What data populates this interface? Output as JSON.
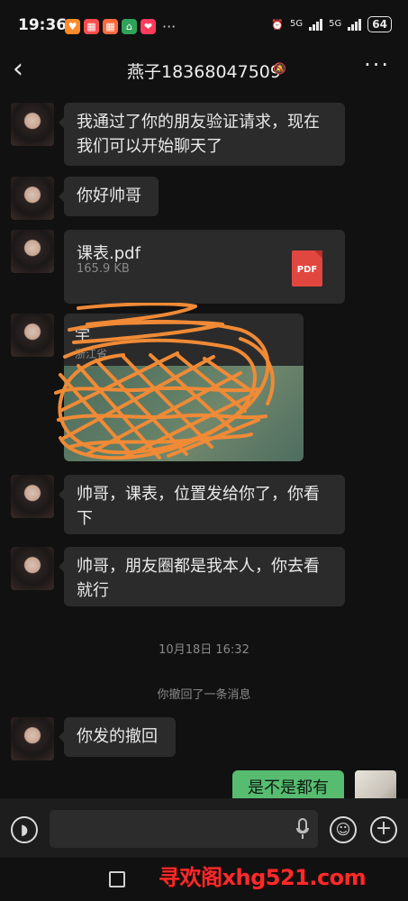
{
  "status_bar": {
    "time": "19:36",
    "network_1": "5G",
    "network_2": "5G",
    "battery": "64",
    "more": "···"
  },
  "header": {
    "title": "燕子18368047509",
    "back_label": "‹",
    "more_label": "···"
  },
  "messages": [
    {
      "type": "text",
      "text": "我通过了你的朋友验证请求，现在我们可以开始聊天了"
    },
    {
      "type": "text",
      "text": "你好帅哥"
    },
    {
      "type": "file",
      "file_name": "课表.pdf",
      "file_size": "165.9 KB",
      "file_badge": "PDF"
    },
    {
      "type": "location",
      "name": "宇",
      "address": "浙江省"
    },
    {
      "type": "text",
      "text": "帅哥，课表，位置发给你了，你看下"
    },
    {
      "type": "text",
      "text": "帅哥，朋友圈都是我本人，你去看就行"
    },
    {
      "type": "text",
      "text": "你发的撤回"
    }
  ],
  "timestamp": "10月18日 16:32",
  "system_message": "你撤回了一条消息",
  "my_message": "是不是都有",
  "watermark": "寻欢阁xhg521.com",
  "colors": {
    "background": "#111111",
    "bubble": "#2b2b2b",
    "my_bubble": "#57bc70",
    "scribble": "#f08a36"
  }
}
